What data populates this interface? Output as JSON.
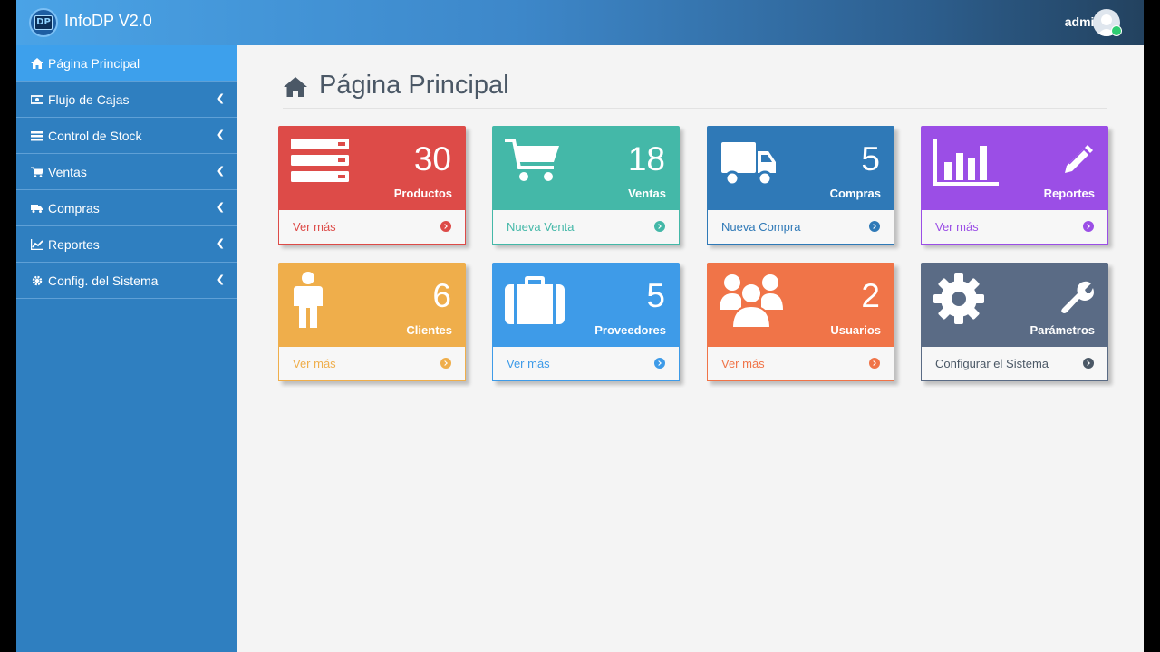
{
  "header": {
    "brand": "InfoDP V2.0",
    "logo_text": "DP",
    "user": "admin"
  },
  "sidebar": {
    "items": [
      {
        "label": "Página Principal",
        "icon": "home-icon",
        "active": true
      },
      {
        "label": "Flujo de Cajas",
        "icon": "money-icon"
      },
      {
        "label": "Control de Stock",
        "icon": "list-icon"
      },
      {
        "label": "Ventas",
        "icon": "cart-icon"
      },
      {
        "label": "Compras",
        "icon": "truck-icon"
      },
      {
        "label": "Reportes",
        "icon": "line-chart-icon"
      },
      {
        "label": "Config. del Sistema",
        "icon": "gear-icon"
      }
    ]
  },
  "page": {
    "title": "Página Principal"
  },
  "cards": [
    {
      "value": "30",
      "label": "Productos",
      "link": "Ver más",
      "color": "#dd4b48",
      "icon": "server-icon"
    },
    {
      "value": "18",
      "label": "Ventas",
      "link": "Nueva Venta",
      "color": "#44b8a8",
      "icon": "shopping-cart-icon"
    },
    {
      "value": "5",
      "label": "Compras",
      "link": "Nueva Compra",
      "color": "#2f79b7",
      "icon": "truck-icon"
    },
    {
      "value": "",
      "label": "Reportes",
      "link": "Ver más",
      "color": "#9b4ee6",
      "icon": "bar-chart-icon"
    },
    {
      "value": "6",
      "label": "Clientes",
      "link": "Ver más",
      "color": "#efae4b",
      "icon": "male-icon"
    },
    {
      "value": "5",
      "label": "Proveedores",
      "link": "Ver más",
      "color": "#3e9be8",
      "icon": "suitcase-icon"
    },
    {
      "value": "2",
      "label": "Usuarios",
      "link": "Ver más",
      "color": "#f07448",
      "icon": "users-icon"
    },
    {
      "value": "",
      "label": "Parámetros",
      "link": "Configurar el Sistema",
      "color": "#5a6b85",
      "icon": "cog-icon"
    }
  ]
}
